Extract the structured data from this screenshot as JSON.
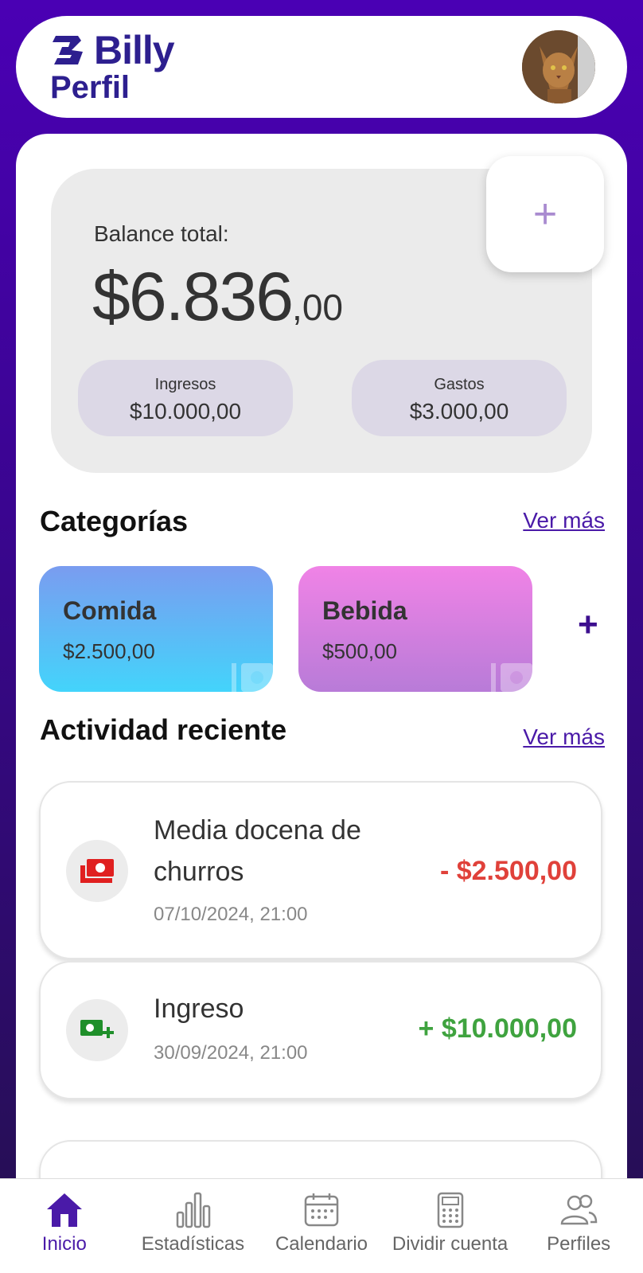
{
  "header": {
    "brand": "Billy",
    "page_title": "Perfil"
  },
  "balance": {
    "label": "Balance total:",
    "amount_int": "$6.836",
    "amount_dec": ",00",
    "ingresos_label": "Ingresos",
    "ingresos_value": "$10.000,00",
    "gastos_label": "Gastos",
    "gastos_value": "$3.000,00",
    "add_symbol": "+"
  },
  "categories": {
    "title": "Categorías",
    "see_more": "Ver más",
    "add_symbol": "+",
    "items": [
      {
        "name": "Comida",
        "value": "$2.500,00"
      },
      {
        "name": "Bebida",
        "value": "$500,00"
      }
    ]
  },
  "activity": {
    "title": "Actividad reciente",
    "see_more": "Ver más",
    "items": [
      {
        "title_line1": "Media docena de",
        "title_line2": "churros",
        "date": "07/10/2024, 21:00",
        "amount": "- $2.500,00",
        "icon": "expense-cash-icon"
      },
      {
        "title_line1": "Ingreso",
        "date": "30/09/2024, 21:00",
        "amount": "+ $10.000,00",
        "icon": "income-cash-icon"
      }
    ]
  },
  "nav": {
    "items": [
      {
        "label": "Inicio",
        "icon": "home-icon",
        "active": true
      },
      {
        "label": "Estadísticas",
        "icon": "stats-icon",
        "active": false
      },
      {
        "label": "Calendario",
        "icon": "calendar-icon",
        "active": false
      },
      {
        "label": "Dividir cuenta",
        "icon": "calculator-icon",
        "active": false
      },
      {
        "label": "Perfiles",
        "icon": "profiles-icon",
        "active": false
      }
    ]
  },
  "colors": {
    "brand": "#2d1f8f",
    "accent": "#4a1aa8",
    "expense": "#e0413a",
    "income": "#3fa33f"
  }
}
